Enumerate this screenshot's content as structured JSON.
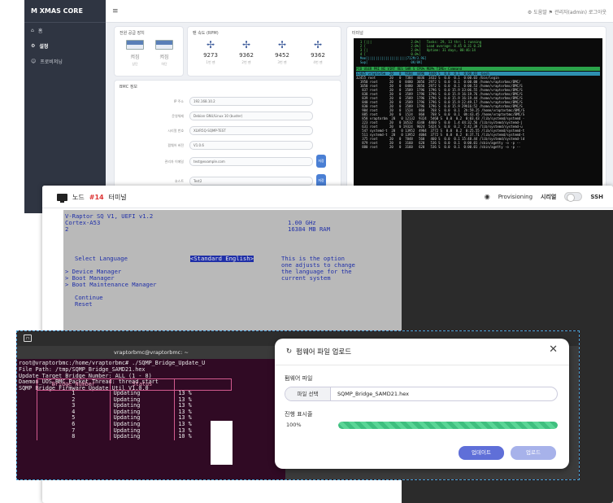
{
  "dashboard": {
    "logo": "M XMAS CORE",
    "menu_icon": "≡",
    "sidebar": [
      {
        "icon": "home-icon",
        "label": "홈"
      },
      {
        "icon": "gear-icon",
        "label": "설정"
      },
      {
        "icon": "user-icon",
        "label": "프로비저닝"
      }
    ],
    "topbar_user": "⚙ 도움말  ⚑ 관리자(admin) 로그아웃",
    "device_card": {
      "title": "전원 공급 장치",
      "devices": [
        {
          "val": "켜짐",
          "sub": "상단"
        },
        {
          "val": "켜짐",
          "sub": "하단"
        }
      ]
    },
    "fan_card": {
      "title": "팬 속도 (RPM)",
      "fans": [
        {
          "val": "9273",
          "sub": "1번 팬"
        },
        {
          "val": "9362",
          "sub": "2번 팬"
        },
        {
          "val": "9452",
          "sub": "3번 팬"
        },
        {
          "val": "9362",
          "sub": "4번 팬"
        }
      ]
    },
    "bmc_card": {
      "title": "BMC 정보",
      "fields": [
        {
          "label": "IP 주소",
          "value": "192.168.10.2"
        },
        {
          "label": "운영체제",
          "value": "Debian GNU/Linux 10 (buster)"
        },
        {
          "label": "시리얼 번호",
          "value": "XLVR5Q-SQMP-TEST"
        },
        {
          "label": "펌웨어 버전",
          "value": "V1.0.6"
        },
        {
          "label": "관리자 이메일",
          "value": "test@example.com",
          "button": "저장"
        },
        {
          "label": "호스트",
          "value": "Test2",
          "button": "저장"
        }
      ]
    },
    "terminal_card": {
      "title": "터미널"
    },
    "htop": {
      "lines": [
        "  1 [|||                    2.0%]   Tasks: 29, 13 thr; 1 running",
        "  2 [                       2.0%]   Load average: 0.45 0.31 0.28",
        "  3 [|                      2.0%]   Uptime: 31 days, 00:46:14",
        "  4 [                       0.0%]",
        "  Mem[||||||||||||||||||||712M/3.9G]",
        "  Swp[                      0K/0K]"
      ],
      "header": "  PID USER      PRI  NI  VIRT   RES   SHR S CPU% MEM%   TIME+  Command",
      "rows": [
        "32465 vraptorbm  20   0  9184  4496  3440 S  0.0  0.1  0:00.03 -bash",
        "32455 root       20   0  7384  4036  3432 S  0.0  0.1  0:00.03 /bin/login",
        "  1950 root      20   0  8480  3056  2972 S  0.0  0.1  0:00.00 /home/vraptorbmc/BMC/",
        "  1050 root      20   0  8480  3056  2972 S  0.0  0.1  0:00.53 /home/vraptorbmc/BMC/S",
        "   837 root      20   0  3589  1796  1796 S  0.0 15.9 33:06.55 /home/vraptorbmc/BMC/S",
        "   838 root      20   0  3589  1796  1796 S  0.0 15.9 16:19.76 /home/vraptorbmc/BMC/S",
        "   839 root      20   0  3589  1796  1796 S  0.0 15.9 16:19.44 /home/vraptorbmc/BMC/S",
        "   840 root      20   0  3589  1796  1796 S  0.0 15.9 22:49.17 /home/vraptorbmc/BMC/S",
        "   830 root      20   0  3589  1796  1796 S  0.0 15.9 29h16:52 /home/vraptorbmc/BMC/S",
        "   904 root      20   0  1524   860   768 S  0.0  0.1  2h:59.25 /home/vraptorbmc/BMC/S",
        "   885 root      20   0  1524   860   768 S  0.0  0.1  0h:43.45 /home/vraptorbmc/BMC/S",
        "   858 vraptorbm  20   0 12132  9324  5460 S  0.0  0.2  0:03.43 /lib/systemd/systemd -",
        "   223 root      20   0 10532  4340  4460 S  0.0  1.4 44:32.56 /lib/systemd/systemd-j",
        "   631 root      20   0 19324  9024  5424 S  0.0  0.2  2:42.39 /lib/systemd/systemd-u",
        "   547 systemd-t  20   0 13952  4984  3772 S  0.0  0.2  0:25.55 /lib/systemd/systemd-t",
        "   511 systemd-t  20   0 13952  4004  3772 S  0.0  0.2  0:37.71 /lib/systemd/systemd-t",
        "   375 root      20   0  7048   560   460 S  0.0  0.1 15:48.44 /lib/systemd/systemd-ld",
        "   879 root      20   0  3160   620   536 S  0.0  0.1  0:00.01 /sbin/agetty -o -p --",
        "   880 root      20   0  3160   620   536 S  0.0  0.1  0:00.01 /sbin/agetty -o -p --"
      ],
      "selected_row": 0
    }
  },
  "bios_window": {
    "title_prefix": "노드",
    "node": "#14",
    "title_suffix": "터미널",
    "provisioning": "Provisioning",
    "serial": "시리얼",
    "ssh": "SSH",
    "lines": {
      "l1": "V-Raptor SQ V1, UEFI v1.2",
      "l2": "Cortex-A53",
      "l3": "2",
      "freq": "1.00 GHz",
      "ram": "16384 MB RAM",
      "select": "Select Language",
      "lang": "<Standard English>",
      "help1": "This is the option",
      "help2": "one adjusts to change",
      "help3": "the language for the",
      "help4": "current system",
      "m1": "> Device Manager",
      "m2": "> Boot Manager",
      "m3": "> Boot Maintenance Manager",
      "c1": "Continue",
      "c2": "Reset"
    }
  },
  "terminal2": {
    "title": "vraptorbmc@vraptorbmc: ~",
    "lines": [
      "root@vraptorbmc:/home/vraptorbmc# ./SQMP_Bridge_Update_U",
      "File Path: /tmp/SQMP_Bridge_SAMD21.hex",
      "Update Target Bridge Number: ALL (1 - 8)",
      "Daemon_UOS_BMC_Packet_Thread: thread start",
      "SQMP Bridge Firmware Update Util V1.0.0"
    ],
    "table_headers": [
      "Bridge Number",
      "Status",
      ""
    ],
    "rows": [
      {
        "n": "1",
        "status": "Updating",
        "pct": "13 %"
      },
      {
        "n": "2",
        "status": "Updating",
        "pct": "13 %"
      },
      {
        "n": "3",
        "status": "Updating",
        "pct": "13 %"
      },
      {
        "n": "4",
        "status": "Updating",
        "pct": "13 %"
      },
      {
        "n": "5",
        "status": "Updating",
        "pct": "13 %"
      },
      {
        "n": "6",
        "status": "Updating",
        "pct": "13 %"
      },
      {
        "n": "7",
        "status": "Updating",
        "pct": "13 %"
      },
      {
        "n": "8",
        "status": "Updating",
        "pct": "10 %"
      }
    ]
  },
  "upload_dialog": {
    "title": "펌웨어 파일 업로드",
    "file_label": "펌웨어 파일",
    "pick_button": "파일 선택",
    "file_name": "SQMP_Bridge_SAMD21.hex",
    "progress_label": "진행 표시줄",
    "progress_text": "100%",
    "progress_value": 1.0,
    "update_button": "업데이트",
    "upload_button": "업로드"
  }
}
